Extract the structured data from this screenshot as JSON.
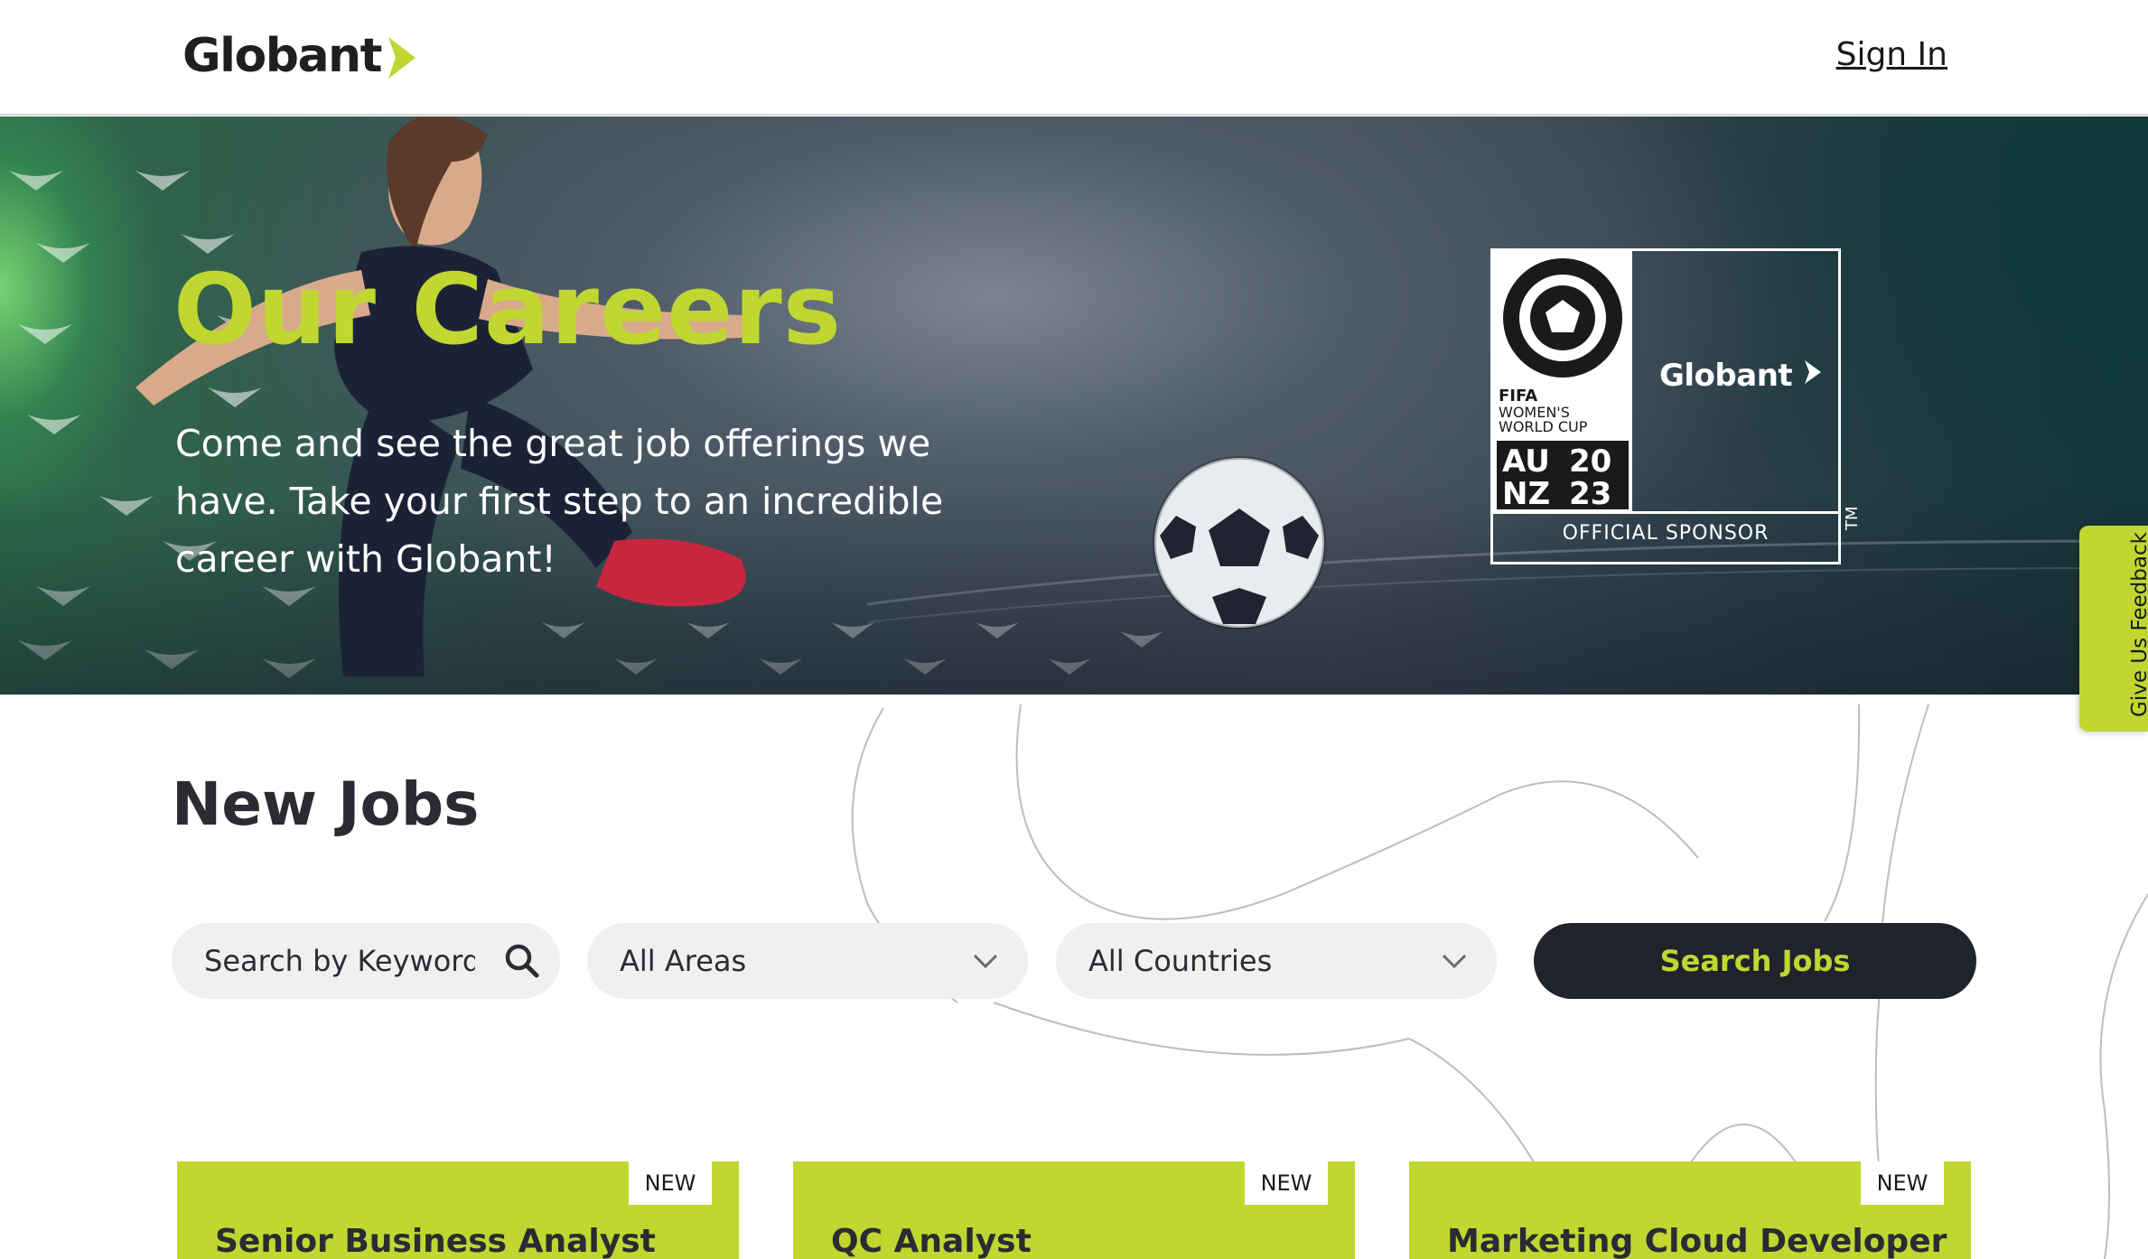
{
  "header": {
    "logo_text": "Globant",
    "signin_label": "Sign In"
  },
  "hero": {
    "title": "Our Careers",
    "description": "Come and see the great job offerings we have. Take your first step to an incredible career with Globant!",
    "sponsor": {
      "emblem_lines": [
        "FIFA",
        "WOMEN'S",
        "WORLD CUP",
        "AU",
        "NZ",
        "20",
        "23"
      ],
      "brand": "Globant",
      "label": "OFFICIAL SPONSOR",
      "tm": "TM"
    }
  },
  "feedback": {
    "label": "Give Us Feedback"
  },
  "jobs": {
    "title": "New Jobs",
    "search_placeholder": "Search by Keyword",
    "areas_value": "All Areas",
    "countries_value": "All Countries",
    "search_button_label": "Search Jobs",
    "cards": [
      {
        "badge": "NEW",
        "title": "Senior Business Analyst"
      },
      {
        "badge": "NEW",
        "title": "QC Analyst"
      },
      {
        "badge": "NEW",
        "title": "Marketing Cloud Developer"
      }
    ]
  },
  "colors": {
    "brand_green": "#bfd730",
    "dark": "#21232b",
    "text": "#2a2b33"
  },
  "icons": {
    "search": "search-icon",
    "chevron": "chevron-down-icon",
    "logo_arrow": "logo-arrow-icon"
  }
}
